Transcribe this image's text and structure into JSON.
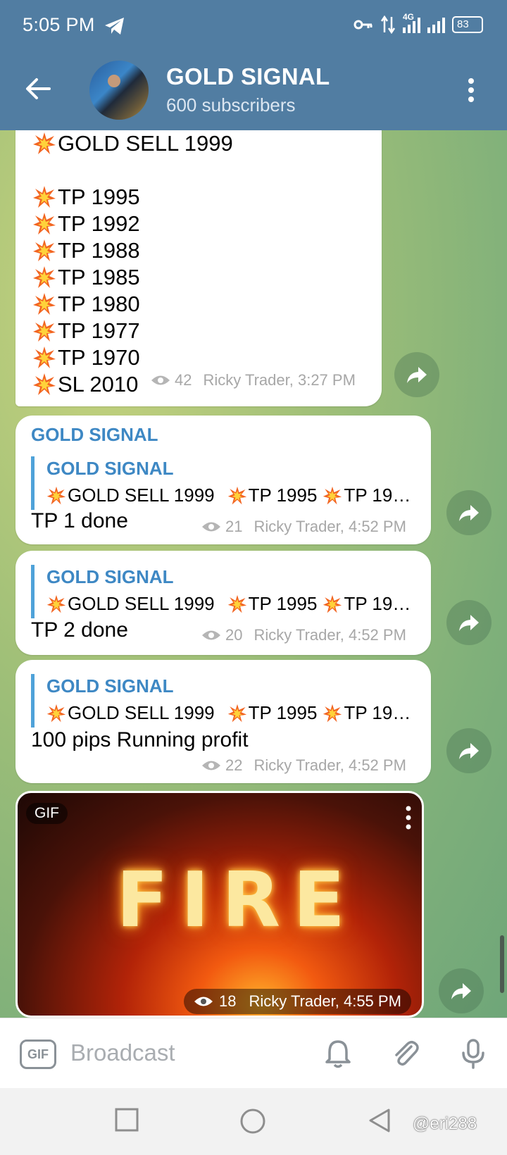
{
  "status_bar": {
    "time": "5:05 PM",
    "network": "4G",
    "battery": "83"
  },
  "header": {
    "title": "GOLD SIGNAL",
    "subtitle": "600 subscribers"
  },
  "messages": [
    {
      "lines": [
        "GOLD SELL 1999",
        "",
        "TP 1995",
        "TP 1992",
        "TP 1988",
        "TP 1985",
        "TP 1980",
        "TP 1977",
        "TP 1970",
        "SL 2010"
      ],
      "views": "42",
      "author_time": "Ricky Trader, 3:27 PM"
    },
    {
      "sender": "GOLD SIGNAL",
      "reply_title": "GOLD SIGNAL",
      "reply_parts": [
        "GOLD SELL 1999 ",
        "TP 1995 ",
        "TP 19…"
      ],
      "text": "TP 1 done",
      "views": "21",
      "author_time": "Ricky Trader, 4:52 PM"
    },
    {
      "reply_title": "GOLD SIGNAL",
      "reply_parts": [
        "GOLD SELL 1999 ",
        "TP 1995 ",
        "TP 19…"
      ],
      "text": "TP 2 done",
      "views": "20",
      "author_time": "Ricky Trader, 4:52 PM"
    },
    {
      "reply_title": "GOLD SIGNAL",
      "reply_parts": [
        "GOLD SELL 1999 ",
        "TP 1995 ",
        "TP 19…"
      ],
      "text": "100 pips Running profit",
      "views": "22",
      "author_time": "Ricky Trader, 4:52 PM"
    },
    {
      "badge": "GIF",
      "gif_text": "FIRE",
      "views": "18",
      "author_time": "Ricky Trader, 4:55 PM"
    }
  ],
  "input": {
    "gif_label": "GIF",
    "placeholder": "Broadcast"
  },
  "watermark": "@eri288",
  "colors": {
    "header": "#517da2",
    "link": "#3e88c4",
    "reply_bar": "#4fa2d9",
    "meta": "#a7a7a7"
  }
}
